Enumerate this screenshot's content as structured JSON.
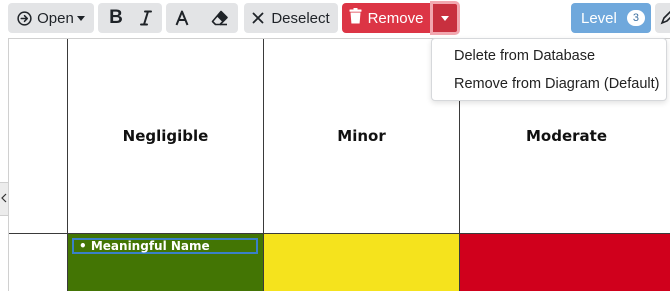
{
  "toolbar": {
    "open_label": "Open",
    "bold_label": "B",
    "deselect_label": "Deselect",
    "remove_label": "Remove",
    "level_label": "Level",
    "level_value": "3"
  },
  "remove_menu": {
    "items": [
      {
        "label": "Delete from Database"
      },
      {
        "label": "Remove from Diagram (Default)"
      }
    ]
  },
  "matrix": {
    "columns": [
      {
        "label": "Negligible"
      },
      {
        "label": "Minor"
      },
      {
        "label": "Moderate"
      }
    ],
    "row1": {
      "cells": [
        {
          "color": "#437504",
          "note": "• Meaningful Name"
        },
        {
          "color": "#f5e31d"
        },
        {
          "color": "#d0001c"
        }
      ]
    }
  },
  "colors": {
    "remove": "#dc3545",
    "level": "#6fa8dc",
    "toolbar_button": "#e3e4e6"
  },
  "icons": [
    "open-circle-arrow-icon",
    "italic-icon",
    "font-color-icon",
    "eraser-icon",
    "close-x-icon",
    "trash-icon",
    "chevron-left-icon"
  ]
}
